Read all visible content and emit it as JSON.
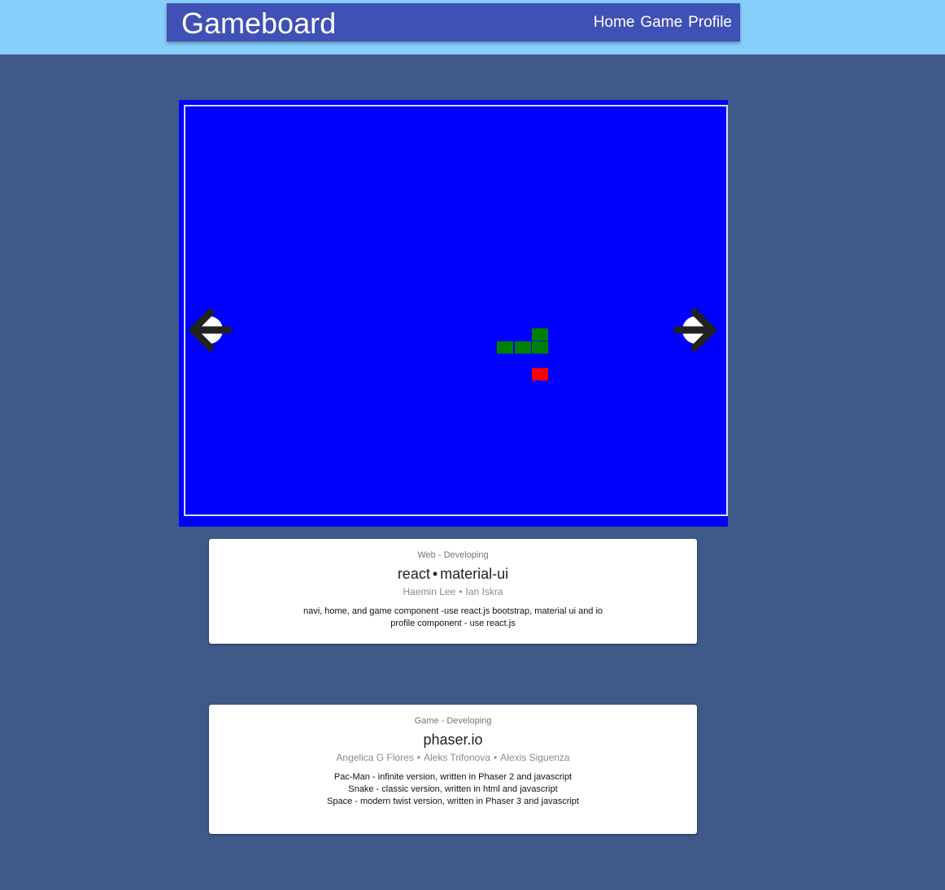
{
  "header": {
    "brand": "Gameboard",
    "nav": [
      "Home",
      "Game",
      "Profile"
    ]
  },
  "game": {
    "left_arrow_icon": "arrow-left-icon",
    "right_arrow_icon": "arrow-right-icon"
  },
  "cards": [
    {
      "category": "Web - Developing",
      "title_parts": [
        "react",
        "material-ui"
      ],
      "authors": [
        "Haemin Lee",
        "Ian Iskra"
      ],
      "lines": [
        "navi, home, and game component -use react.js bootstrap, material ui and io",
        "profile component - use react.js"
      ]
    },
    {
      "category": "Game - Developing",
      "title_parts": [
        "phaser.io"
      ],
      "authors": [
        "Angelica G Flores",
        "Aleks Trifonova",
        "Alexis Siguenza"
      ],
      "lines": [
        "Pac-Man - infinite version, written in Phaser 2 and javascript",
        "Snake - classic version, written in html and javascript",
        "Space - modern twist version, written in Phaser 3 and javascript"
      ]
    }
  ],
  "colors": {
    "page_bg": "#3f5a88",
    "topbar": "#87cefa",
    "appbar": "#3f51b5",
    "game_bg": "#0000ff",
    "snake": "#008000",
    "food": "#ff0000"
  }
}
